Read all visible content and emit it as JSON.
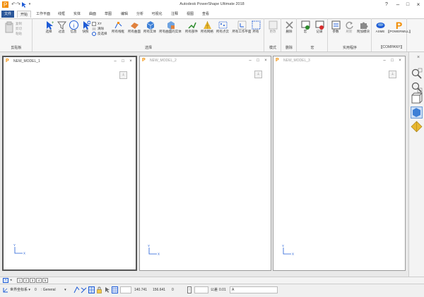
{
  "app": {
    "title": "Autodesk PowerShape Ultimate 2018"
  },
  "tabs": [
    {
      "label": "文件"
    },
    {
      "label": "开始"
    },
    {
      "label": "工作平面"
    },
    {
      "label": "线框"
    },
    {
      "label": "实体"
    },
    {
      "label": "曲面"
    },
    {
      "label": "草图"
    },
    {
      "label": "编辑"
    },
    {
      "label": "分析"
    },
    {
      "label": "可视化"
    },
    {
      "label": "注释"
    },
    {
      "label": "视图"
    },
    {
      "label": "查看"
    }
  ],
  "ribbon": {
    "clipboard": {
      "label": "剪贴板",
      "items": [
        "复制",
        "剪切",
        "粘贴"
      ]
    },
    "select": {
      "label": "选择",
      "buttons": [
        "选择",
        "过滤",
        "信息",
        "快照",
        "所有线框",
        "所有曲面",
        "所有实体",
        "所有曲面的实体",
        "所有部件",
        "所有网格",
        "所有点云",
        "所有工作平面",
        "所有"
      ],
      "small": [
        "清除",
        "反选择"
      ]
    },
    "mode": {
      "label": "模式",
      "buttons": [
        "更改"
      ]
    },
    "delete": {
      "label": "删除",
      "buttons": [
        "删除"
      ]
    },
    "macro": {
      "label": "宏",
      "buttons": [
        "宏",
        "记录"
      ]
    },
    "utilities": {
      "label": "实用程序",
      "buttons": [
        "参数",
        "刷新",
        "附加模块"
      ]
    },
    "company": {
      "label": "[[COMPANY]]",
      "buttons": [
        "ASME",
        "[[POWERMILL]]"
      ]
    }
  },
  "windows": [
    {
      "title": "NEW_MODEL_1",
      "active": true
    },
    {
      "title": "NEW_MODEL_2",
      "active": false
    },
    {
      "title": "NEW_MODEL_3",
      "active": false
    }
  ],
  "axes": {
    "y": "Y",
    "x": "X"
  },
  "sheet_tabs": [
    "1",
    "2",
    "3",
    "4",
    "5"
  ],
  "status": {
    "coord_system": "世界坐标系",
    "level": "0",
    "level_name": ": General",
    "x": "140.741",
    "y": "156.641",
    "z": "0",
    "tolerance_label": "公差",
    "tolerance": "0.01",
    "units": "A"
  },
  "colors": {
    "file_tab": "#2b579a",
    "model_icon": "#f28c00",
    "axis_blue": "#1e5bd6"
  }
}
